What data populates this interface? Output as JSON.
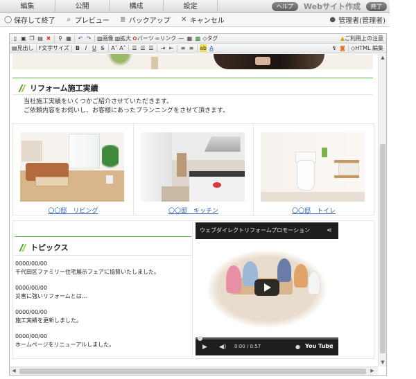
{
  "topmenu": {
    "items": [
      "編集",
      "公開",
      "構成",
      "設定"
    ],
    "help_label": "ヘルプ",
    "web_title": "Webサイト作成",
    "exit_label": "終了"
  },
  "actionbar": {
    "save_close": "保存して終了",
    "preview": "プレビュー",
    "backup": "バックアップ",
    "cancel": "キャンセル",
    "user": "管理者(管理者)"
  },
  "toolbar": {
    "image": "画像",
    "zoom": "拡大",
    "parts": "パーツ",
    "link": "リンク",
    "tag": "タグ",
    "notice": "ご利用上の注意",
    "heading": "見出し",
    "font_size": "文字サイズ",
    "bold": "B",
    "italic": "I",
    "underline": "U",
    "html_edit": "HTML 編集"
  },
  "section": {
    "title": "リフォーム施工実績",
    "line1": "当社施工実績をいくつかご紹介させていただきます。",
    "line2": "ご依頼内容をお伺いし、お客様にあったプランニングをさせて頂きます。"
  },
  "works": [
    {
      "caption": "〇〇邸　リビング"
    },
    {
      "caption": "〇〇邸　キッチン"
    },
    {
      "caption": "〇〇邸　トイレ"
    }
  ],
  "topics": {
    "title": "トピックス",
    "items": [
      {
        "date": "0000/00/00",
        "text": "千代田区ファミリー住宅展示フェアに協賛いたしました。"
      },
      {
        "date": "0000/00/00",
        "text": "災害に強いリフォームとは..."
      },
      {
        "date": "0000/00/00",
        "text": "施工実績を更新しました。"
      },
      {
        "date": "0000/00/00",
        "text": "ホームページをリニューアルしました。"
      }
    ]
  },
  "video": {
    "title": "ウェブダイレクトリフォームプロモーション",
    "time": "0:00 / 0:57",
    "logo": "You Tube"
  },
  "colors": {
    "accent_green": "#57b63a",
    "link_blue": "#2a61b5"
  }
}
